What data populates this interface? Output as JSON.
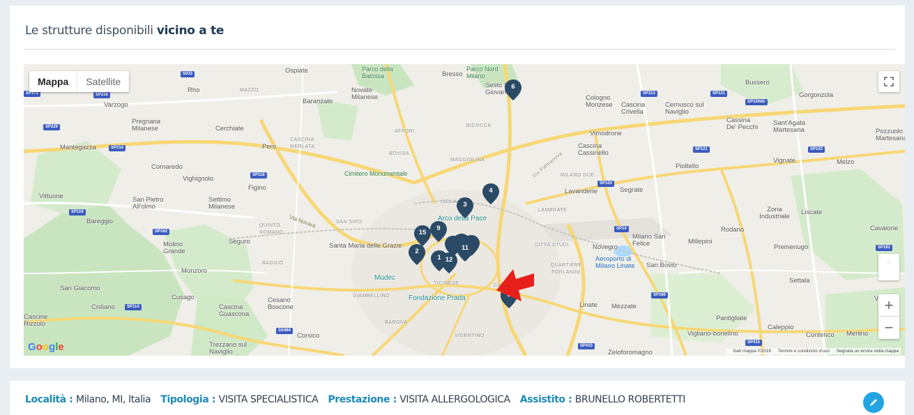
{
  "section": {
    "title_prefix": "Le strutture disponibili ",
    "title_bold": "vicino a te"
  },
  "map": {
    "type_controls": {
      "map": "Mappa",
      "satellite": "Satellite"
    },
    "zoom_in": "+",
    "zoom_out": "−",
    "fullscreen": "⛶",
    "attribution": {
      "data": "Dati mappa ©2019",
      "terms": "Termini e condizioni d'uso",
      "report": "Segnala un errore nella mappa"
    },
    "logo": [
      "G",
      "o",
      "o",
      "g",
      "l",
      "e"
    ],
    "logo_colors": [
      "#4285f4",
      "#ea4335",
      "#fbbc05",
      "#4285f4",
      "#34a853",
      "#ea4335"
    ],
    "markers": [
      {
        "label": "1"
      },
      {
        "label": "2"
      },
      {
        "label": "3"
      },
      {
        "label": "4"
      },
      {
        "label": "5"
      },
      {
        "label": "6"
      },
      {
        "label": "9"
      },
      {
        "label": "11"
      },
      {
        "label": "12"
      },
      {
        "label": "15"
      }
    ],
    "marker_color": "#2b4a66",
    "place_labels": [
      "Ospiate",
      "Rho",
      "MAZZO",
      "Baranzate",
      "Novate Milanese",
      "Parco della Balossa",
      "Bresso",
      "Parco Nord Milano",
      "Sesto San Giovanni",
      "Varzogo",
      "Pregnana Milanese",
      "Cerchiate",
      "Pero",
      "CASCINA MERLATA",
      "AFFORI",
      "BICOCCA",
      "BOVISA",
      "Cologno Monzese",
      "Cascina Crivella",
      "Cernusco sul Naviglio",
      "Bussero",
      "Gorgonzola",
      "Cassina De' Pecchi",
      "Sant'Agata Martesana",
      "Pozzuolo Martesana",
      "Mantegazza",
      "Vimodrone",
      "Cascina Cassinello",
      "Cornaredo",
      "Vighignolo",
      "Figino",
      "MAGGIOLINA",
      "Via Palmanova",
      "Pioltello",
      "Melzo",
      "Vignate",
      "Vittuone",
      "San Pietro All'olmo",
      "Settimo Milanese",
      "Cimitero Monumentale",
      "MILANO DUE",
      "Lavanderie",
      "Segrate",
      "Bareggio",
      "ISOLA",
      "Arco della Pace",
      "QUINTO ROMANO",
      "SAN SIRO",
      "Via Novara",
      "LAMBRATE",
      "Zona Industriale",
      "Liscate",
      "Molino Grande",
      "Seguro",
      "Santa Maria delle Grazie",
      "CITTÀ STUDI",
      "Milano San Felice",
      "Novegro",
      "Millepini",
      "Rodano",
      "Premenugo",
      "Cavaione",
      "BAGGIO",
      "Monzoro",
      "Aeroporto di Milano Linate",
      "QUARTIERE FORLANINI",
      "San Bovio",
      "Settala",
      "San Giacomo",
      "Cusago",
      "Cesano Boscone",
      "Mudec",
      "TICINESE",
      "Fondazione Prada",
      "CALVAIRATE",
      "GIAMBELLINO",
      "Cisliano",
      "Cascina Guascona",
      "Linate",
      "Mezzate",
      "Vaia",
      "Cascine Rizzolo",
      "Corsico",
      "BARONA",
      "VIGENTINO",
      "Pantigliate",
      "Caleppio",
      "Vigliano-bonelino",
      "Contenco",
      "Merlino",
      "Trezzano sul Naviglio",
      "Zeloforomagno"
    ]
  },
  "filters": [
    {
      "label": "Località",
      "value": "Milano, MI, Italia"
    },
    {
      "label": "Tipologia",
      "value": "VISITA SPECIALISTICA"
    },
    {
      "label": "Prestazione",
      "value": "VISITA ALLERGOLOGICA"
    },
    {
      "label": "Assistito",
      "value": "BRUNELLO ROBERTETTI"
    }
  ],
  "colors": {
    "accent": "#1e8ab8",
    "edit_button": "#23a5e3",
    "arrow": "#e8201c"
  },
  "icons": {
    "edit": "pencil-icon",
    "arrow": "red-arrow-icon",
    "pegman": "pegman-icon"
  }
}
